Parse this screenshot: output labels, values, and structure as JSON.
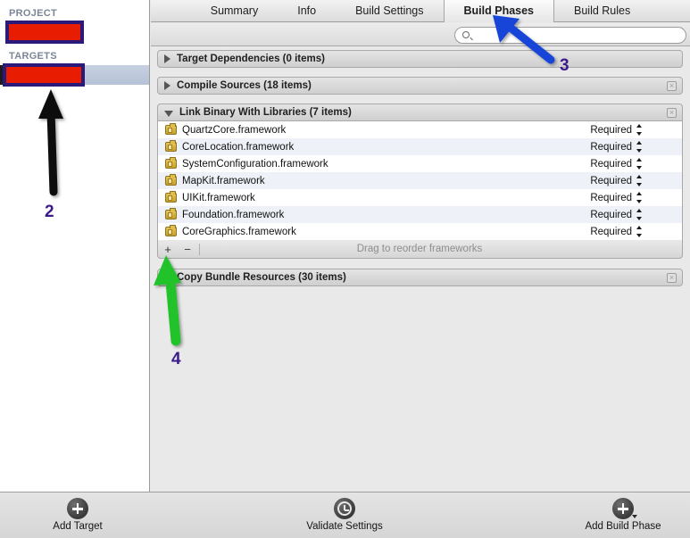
{
  "sidebar": {
    "project_header": "PROJECT",
    "targets_header": "TARGETS",
    "project_item_redacted": "",
    "target_item_redacted": ""
  },
  "tabs": [
    {
      "label": "Summary",
      "selected": false
    },
    {
      "label": "Info",
      "selected": false
    },
    {
      "label": "Build Settings",
      "selected": false
    },
    {
      "label": "Build Phases",
      "selected": true
    },
    {
      "label": "Build Rules",
      "selected": false
    }
  ],
  "search": {
    "value": "",
    "placeholder": "",
    "icon": "search-icon"
  },
  "phases": [
    {
      "title": "Target Dependencies (0 items)",
      "expanded": false,
      "has_delete": false
    },
    {
      "title": "Compile Sources (18 items)",
      "expanded": false,
      "has_delete": true
    },
    {
      "title": "Link Binary With Libraries (7 items)",
      "expanded": true,
      "has_delete": true
    },
    {
      "title": "Copy Bundle Resources (30 items)",
      "expanded": false,
      "has_delete": true
    }
  ],
  "frameworks": {
    "status_label": "Required",
    "rows": [
      {
        "name": "QuartzCore.framework",
        "status": "Required"
      },
      {
        "name": "CoreLocation.framework",
        "status": "Required"
      },
      {
        "name": "SystemConfiguration.framework",
        "status": "Required"
      },
      {
        "name": "MapKit.framework",
        "status": "Required"
      },
      {
        "name": "UIKit.framework",
        "status": "Required"
      },
      {
        "name": "Foundation.framework",
        "status": "Required"
      },
      {
        "name": "CoreGraphics.framework",
        "status": "Required"
      }
    ]
  },
  "reorder_bar": {
    "add_label": "+",
    "remove_label": "−",
    "hint": "Drag to reorder frameworks"
  },
  "bottom_toolbar": [
    {
      "label": "Add Target",
      "icon": "plus-circle-icon"
    },
    {
      "label": "Validate Settings",
      "icon": "clock-icon"
    },
    {
      "label": "Add Build Phase",
      "icon": "plus-circle-dropdown-icon"
    }
  ],
  "annotations": [
    {
      "number": "2",
      "color": "#3b1a8c",
      "arrow_color": "#0b0b0b",
      "points_to": "selected-target-row"
    },
    {
      "number": "3",
      "color": "#3b1a8c",
      "arrow_color": "#1545d8",
      "points_to": "tab-build-phases"
    },
    {
      "number": "4",
      "color": "#3b1a8c",
      "arrow_color": "#22c32a",
      "points_to": "add-framework-button"
    }
  ],
  "colors": {
    "redact_fill": "#e81c00",
    "redact_border": "#2b1a7a",
    "selection": "#b6c2d6",
    "annotation_text": "#3b1a8c"
  }
}
